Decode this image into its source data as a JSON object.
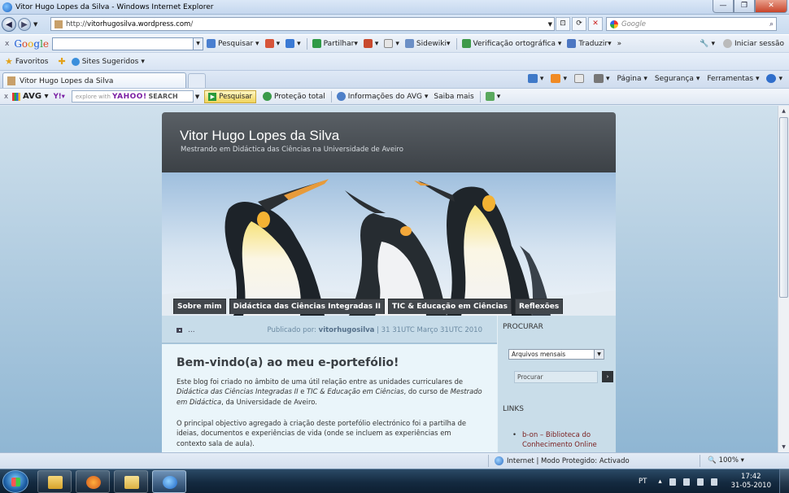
{
  "window": {
    "title": "Vitor Hugo Lopes da Silva - Windows Internet Explorer",
    "minimize": "—",
    "restore": "❐",
    "close": "✕"
  },
  "address": {
    "url_prefix": "http://",
    "url_host": "vitorhugosilva.wordpress.com",
    "url_suffix": "/",
    "search_placeholder": "Google"
  },
  "google_toolbar": {
    "close": "x",
    "logo": [
      "G",
      "o",
      "o",
      "g",
      "l",
      "e"
    ],
    "items": [
      "Pesquisar",
      "Partilhar",
      "Sidewiki",
      "Verificação ortográfica",
      "Traduzir"
    ],
    "more": "»",
    "signin": "Iniciar sessão"
  },
  "favorites": {
    "label": "Favoritos",
    "suggested": "Sites Sugeridos"
  },
  "tab": {
    "title": "Vitor Hugo Lopes da Silva"
  },
  "commands": [
    "Página",
    "Segurança",
    "Ferramentas"
  ],
  "avg_toolbar": {
    "close": "x",
    "logo": "AVG",
    "explore": "explore with",
    "yahoo": "YAHOO!",
    "search": "SEARCH",
    "search_button": "Pesquisar",
    "protection": "Proteção total",
    "info": "Informações do AVG",
    "learn_more": "Saiba mais"
  },
  "blog": {
    "title": "Vitor Hugo Lopes da Silva",
    "subtitle": "Mestrando em Didáctica das Ciências na Universidade de Aveiro",
    "nav": [
      "Sobre mim",
      "Didáctica das Ciências Integradas II",
      "TIC & Educação em Ciências",
      "Reflexões"
    ],
    "post_meta": {
      "dots": "...",
      "published_by": "Publicado por:",
      "author": "vitorhugosilva",
      "date": "| 31 31UTC Março 31UTC 2010"
    },
    "post": {
      "title": "Bem-vindo(a) ao meu e-portefólio!",
      "p1_a": "Este blog foi criado no âmbito de uma útil relação entre as unidades curriculares de ",
      "p1_b": "Didáctica das Ciências Integradas II",
      "p1_c": " e ",
      "p1_d": "TIC & Educação em Ciências",
      "p1_e": ", do curso de ",
      "p1_f": "Mestrado em Didáctica",
      "p1_g": ", da Universidade de Aveiro.",
      "p2": "O principal objectivo agregado à criação deste portefólio electrónico foi a partilha de ideias, documentos e  experiências de vida (onde se incluem as experiências em contexto sala de aula)."
    },
    "sidebar": {
      "search_heading": "PROCURAR",
      "archive_select": "Arquivos mensais",
      "search_placeholder": "Procurar",
      "search_go": "›",
      "links_heading": "LINKS",
      "links": [
        "b-on – Biblioteca do Conhecimento Online"
      ]
    }
  },
  "status": {
    "zone": "Internet | Modo Protegido: Activado",
    "zoom": "100%"
  },
  "taskbar": {
    "lang": "PT",
    "time": "17:42",
    "date": "31-05-2010"
  }
}
